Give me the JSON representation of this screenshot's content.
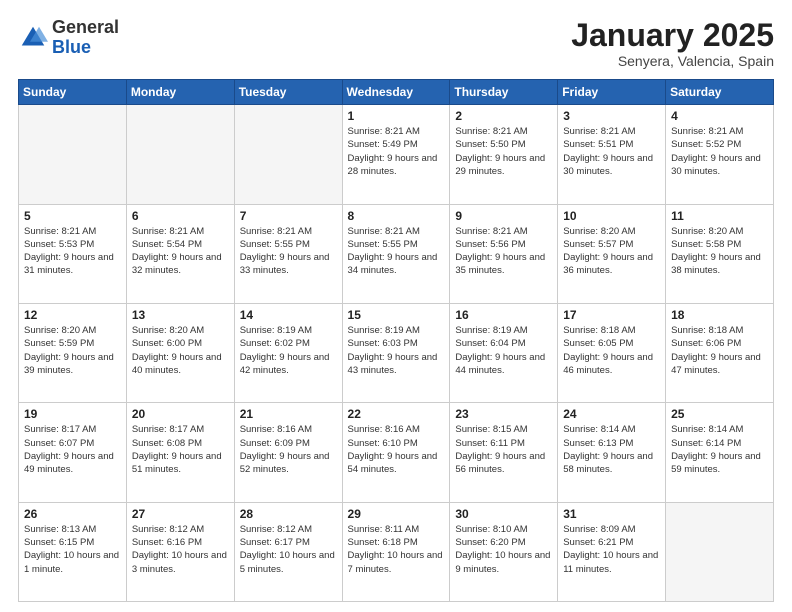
{
  "logo": {
    "general": "General",
    "blue": "Blue"
  },
  "title": "January 2025",
  "subtitle": "Senyera, Valencia, Spain",
  "headers": [
    "Sunday",
    "Monday",
    "Tuesday",
    "Wednesday",
    "Thursday",
    "Friday",
    "Saturday"
  ],
  "weeks": [
    [
      {
        "day": "",
        "info": ""
      },
      {
        "day": "",
        "info": ""
      },
      {
        "day": "",
        "info": ""
      },
      {
        "day": "1",
        "info": "Sunrise: 8:21 AM\nSunset: 5:49 PM\nDaylight: 9 hours\nand 28 minutes."
      },
      {
        "day": "2",
        "info": "Sunrise: 8:21 AM\nSunset: 5:50 PM\nDaylight: 9 hours\nand 29 minutes."
      },
      {
        "day": "3",
        "info": "Sunrise: 8:21 AM\nSunset: 5:51 PM\nDaylight: 9 hours\nand 30 minutes."
      },
      {
        "day": "4",
        "info": "Sunrise: 8:21 AM\nSunset: 5:52 PM\nDaylight: 9 hours\nand 30 minutes."
      }
    ],
    [
      {
        "day": "5",
        "info": "Sunrise: 8:21 AM\nSunset: 5:53 PM\nDaylight: 9 hours\nand 31 minutes."
      },
      {
        "day": "6",
        "info": "Sunrise: 8:21 AM\nSunset: 5:54 PM\nDaylight: 9 hours\nand 32 minutes."
      },
      {
        "day": "7",
        "info": "Sunrise: 8:21 AM\nSunset: 5:55 PM\nDaylight: 9 hours\nand 33 minutes."
      },
      {
        "day": "8",
        "info": "Sunrise: 8:21 AM\nSunset: 5:55 PM\nDaylight: 9 hours\nand 34 minutes."
      },
      {
        "day": "9",
        "info": "Sunrise: 8:21 AM\nSunset: 5:56 PM\nDaylight: 9 hours\nand 35 minutes."
      },
      {
        "day": "10",
        "info": "Sunrise: 8:20 AM\nSunset: 5:57 PM\nDaylight: 9 hours\nand 36 minutes."
      },
      {
        "day": "11",
        "info": "Sunrise: 8:20 AM\nSunset: 5:58 PM\nDaylight: 9 hours\nand 38 minutes."
      }
    ],
    [
      {
        "day": "12",
        "info": "Sunrise: 8:20 AM\nSunset: 5:59 PM\nDaylight: 9 hours\nand 39 minutes."
      },
      {
        "day": "13",
        "info": "Sunrise: 8:20 AM\nSunset: 6:00 PM\nDaylight: 9 hours\nand 40 minutes."
      },
      {
        "day": "14",
        "info": "Sunrise: 8:19 AM\nSunset: 6:02 PM\nDaylight: 9 hours\nand 42 minutes."
      },
      {
        "day": "15",
        "info": "Sunrise: 8:19 AM\nSunset: 6:03 PM\nDaylight: 9 hours\nand 43 minutes."
      },
      {
        "day": "16",
        "info": "Sunrise: 8:19 AM\nSunset: 6:04 PM\nDaylight: 9 hours\nand 44 minutes."
      },
      {
        "day": "17",
        "info": "Sunrise: 8:18 AM\nSunset: 6:05 PM\nDaylight: 9 hours\nand 46 minutes."
      },
      {
        "day": "18",
        "info": "Sunrise: 8:18 AM\nSunset: 6:06 PM\nDaylight: 9 hours\nand 47 minutes."
      }
    ],
    [
      {
        "day": "19",
        "info": "Sunrise: 8:17 AM\nSunset: 6:07 PM\nDaylight: 9 hours\nand 49 minutes."
      },
      {
        "day": "20",
        "info": "Sunrise: 8:17 AM\nSunset: 6:08 PM\nDaylight: 9 hours\nand 51 minutes."
      },
      {
        "day": "21",
        "info": "Sunrise: 8:16 AM\nSunset: 6:09 PM\nDaylight: 9 hours\nand 52 minutes."
      },
      {
        "day": "22",
        "info": "Sunrise: 8:16 AM\nSunset: 6:10 PM\nDaylight: 9 hours\nand 54 minutes."
      },
      {
        "day": "23",
        "info": "Sunrise: 8:15 AM\nSunset: 6:11 PM\nDaylight: 9 hours\nand 56 minutes."
      },
      {
        "day": "24",
        "info": "Sunrise: 8:14 AM\nSunset: 6:13 PM\nDaylight: 9 hours\nand 58 minutes."
      },
      {
        "day": "25",
        "info": "Sunrise: 8:14 AM\nSunset: 6:14 PM\nDaylight: 9 hours\nand 59 minutes."
      }
    ],
    [
      {
        "day": "26",
        "info": "Sunrise: 8:13 AM\nSunset: 6:15 PM\nDaylight: 10 hours\nand 1 minute."
      },
      {
        "day": "27",
        "info": "Sunrise: 8:12 AM\nSunset: 6:16 PM\nDaylight: 10 hours\nand 3 minutes."
      },
      {
        "day": "28",
        "info": "Sunrise: 8:12 AM\nSunset: 6:17 PM\nDaylight: 10 hours\nand 5 minutes."
      },
      {
        "day": "29",
        "info": "Sunrise: 8:11 AM\nSunset: 6:18 PM\nDaylight: 10 hours\nand 7 minutes."
      },
      {
        "day": "30",
        "info": "Sunrise: 8:10 AM\nSunset: 6:20 PM\nDaylight: 10 hours\nand 9 minutes."
      },
      {
        "day": "31",
        "info": "Sunrise: 8:09 AM\nSunset: 6:21 PM\nDaylight: 10 hours\nand 11 minutes."
      },
      {
        "day": "",
        "info": ""
      }
    ]
  ]
}
